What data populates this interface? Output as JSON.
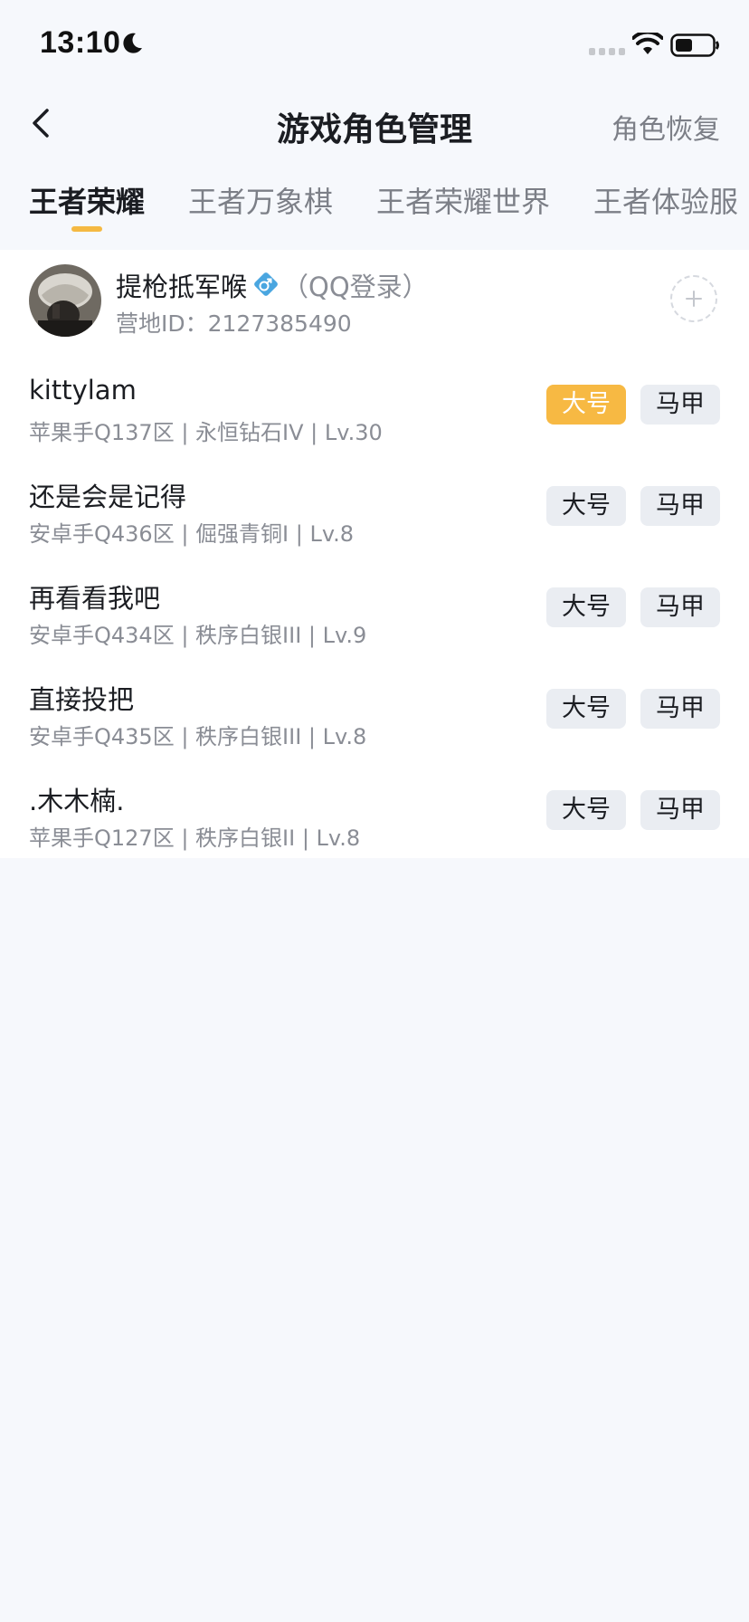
{
  "status_bar": {
    "time": "13:10"
  },
  "nav": {
    "title": "游戏角色管理",
    "restore_label": "角色恢复"
  },
  "tabs": [
    {
      "label": "王者荣耀",
      "active": true
    },
    {
      "label": "王者万象棋",
      "active": false
    },
    {
      "label": "王者荣耀世界",
      "active": false
    },
    {
      "label": "王者体验服",
      "active": false
    }
  ],
  "account": {
    "name": "提枪抵军喉",
    "login_type": "（QQ登录）",
    "camp_id": "营地ID：2127385490"
  },
  "roles": [
    {
      "name": "kittylam",
      "detail": "苹果手Q137区 | 永恒钻石IV | Lv.30",
      "main_label": "大号",
      "alt_label": "马甲",
      "main_selected": true
    },
    {
      "name": "还是会是记得",
      "detail": "安卓手Q436区 | 倔强青铜I | Lv.8",
      "main_label": "大号",
      "alt_label": "马甲",
      "main_selected": false
    },
    {
      "name": "再看看我吧",
      "detail": "安卓手Q434区 | 秩序白银III | Lv.9",
      "main_label": "大号",
      "alt_label": "马甲",
      "main_selected": false
    },
    {
      "name": "直接投把",
      "detail": "安卓手Q435区 | 秩序白银III | Lv.8",
      "main_label": "大号",
      "alt_label": "马甲",
      "main_selected": false
    },
    {
      "name": ".木木楠.",
      "detail": "苹果手Q127区 | 秩序白银II | Lv.8",
      "main_label": "大号",
      "alt_label": "马甲",
      "main_selected": false
    }
  ],
  "colors": {
    "accent": "#f7b943",
    "background": "#f6f8fc",
    "tag_bg": "#eaedf2"
  },
  "icons": [
    "moon-icon",
    "signal-icon",
    "wifi-icon",
    "battery-icon",
    "back-chevron-icon",
    "male-gender-icon",
    "add-icon"
  ]
}
